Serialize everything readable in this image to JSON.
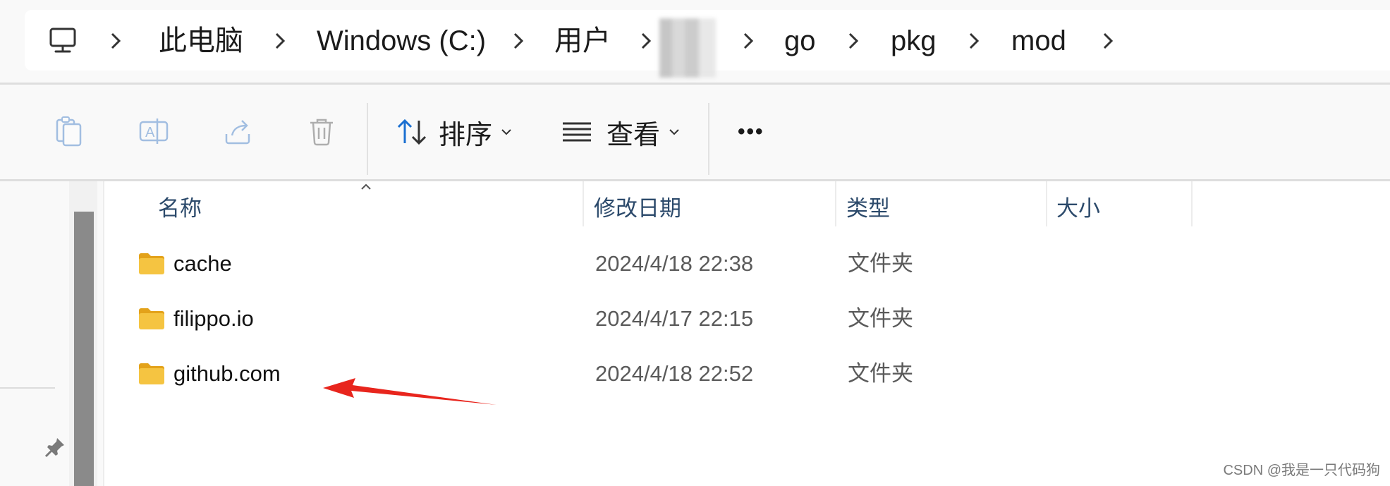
{
  "breadcrumb": {
    "items": [
      "此电脑",
      "Windows (C:)",
      "用户",
      "go",
      "pkg",
      "mod"
    ],
    "blurred_segment": true
  },
  "toolbar": {
    "icons": [
      "copy-icon",
      "rename-icon",
      "share-icon",
      "delete-icon"
    ],
    "sort_label": "排序",
    "view_label": "查看",
    "more_label": "•••"
  },
  "columns": {
    "name": "名称",
    "modified": "修改日期",
    "type": "类型",
    "size": "大小"
  },
  "files": [
    {
      "name": "cache",
      "modified": "2024/4/18 22:38",
      "type": "文件夹"
    },
    {
      "name": "filippo.io",
      "modified": "2024/4/17 22:15",
      "type": "文件夹"
    },
    {
      "name": "github.com",
      "modified": "2024/4/18 22:52",
      "type": "文件夹"
    }
  ],
  "annotation": {
    "arrow_color": "#e8251d",
    "points_to": "github.com"
  },
  "watermark": "CSDN @我是一只代码狗",
  "colors": {
    "folder": "#f5c441",
    "folder_dark": "#e3a21a",
    "accent": "#1a6fd1"
  }
}
